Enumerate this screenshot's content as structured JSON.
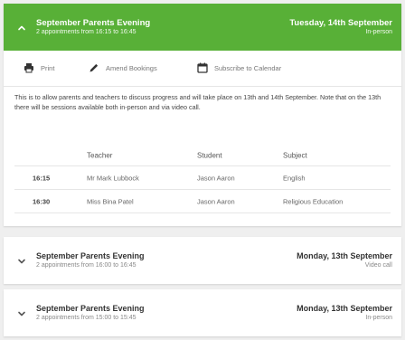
{
  "open_event": {
    "title": "September Parents Evening",
    "subtitle": "2 appointments from 16:15 to 16:45",
    "date": "Tuesday, 14th September",
    "mode": "In-person",
    "accent_color": "#58b037"
  },
  "toolbar": {
    "print_label": "Print",
    "amend_label": "Amend Bookings",
    "subscribe_label": "Subscribe to Calendar"
  },
  "description": "This is to allow parents and teachers to discuss progress and will take place on 13th and 14th September. Note that on the 13th there will be sessions available both in-person and via video call.",
  "table": {
    "headers": {
      "time": "",
      "teacher": "Teacher",
      "student": "Student",
      "subject": "Subject"
    },
    "rows": [
      {
        "time": "16:15",
        "teacher": "Mr Mark Lubbock",
        "student": "Jason Aaron",
        "subject": "English"
      },
      {
        "time": "16:30",
        "teacher": "Miss Bina Patel",
        "student": "Jason Aaron",
        "subject": "Religious Education"
      }
    ]
  },
  "collapsed_events": [
    {
      "title": "September Parents Evening",
      "subtitle": "2 appointments from 16:00 to 16:45",
      "date": "Monday, 13th September",
      "mode": "Video call"
    },
    {
      "title": "September Parents Evening",
      "subtitle": "2 appointments from 15:00 to 15:45",
      "date": "Monday, 13th September",
      "mode": "In-person"
    }
  ],
  "icons": {
    "collapse": "chevron-up-icon",
    "expand": "chevron-down-icon",
    "print": "printer-icon",
    "amend": "pencil-icon",
    "subscribe": "calendar-icon"
  }
}
